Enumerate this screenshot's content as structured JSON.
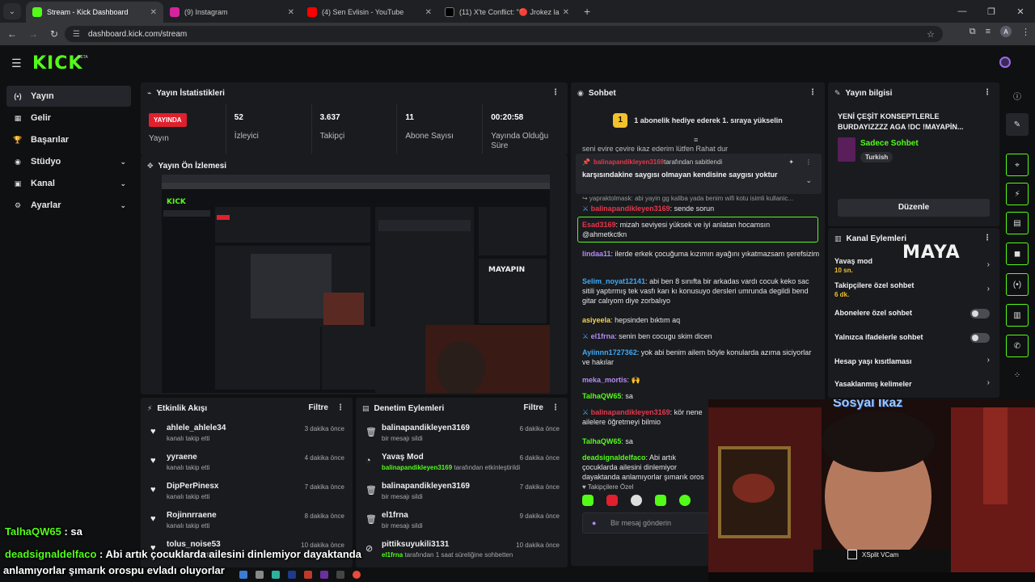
{
  "browser": {
    "tabs": [
      {
        "label": "Stream - Kick Dashboard",
        "color": "#53fc18"
      },
      {
        "label": "(9) Instagram",
        "color": "#d6249f"
      },
      {
        "label": "(4) Sen Evlisin - YouTube",
        "color": "#ff0000"
      },
      {
        "label": "(11) X'te Conflict: \"🔴 Jrokez la",
        "color": "#111111"
      }
    ],
    "url": "dashboard.kick.com/stream",
    "profile": "A"
  },
  "header": {
    "logo": "KICK",
    "beta": "BETA"
  },
  "sidebar": {
    "items": [
      {
        "label": "Yayın",
        "icon": "(•)"
      },
      {
        "label": "Gelir",
        "icon": "▦"
      },
      {
        "label": "Başarılar",
        "icon": "🏆"
      },
      {
        "label": "Stüdyo",
        "icon": "◉"
      },
      {
        "label": "Kanal",
        "icon": "▣"
      },
      {
        "label": "Ayarlar",
        "icon": "⚙"
      }
    ]
  },
  "stats_panel": {
    "title": "Yayın İstatistikleri",
    "live": "YAYINDA",
    "live_label": "Yayın",
    "stats": [
      {
        "value": "52",
        "label": "İzleyici"
      },
      {
        "value": "3.637",
        "label": "Takipçi"
      },
      {
        "value": "11",
        "label": "Abone Sayısı"
      },
      {
        "value": "00:20:58",
        "label": "Yayında Olduğu Süre"
      }
    ]
  },
  "preview_panel": {
    "title": "Yayın Ön İzlemesi"
  },
  "activity_panel": {
    "title": "Etkinlik Akışı",
    "filter": "Filtre",
    "items": [
      {
        "name": "ahlele_ahlele34",
        "desc": "kanalı takip etti",
        "time": "3 dakika önce"
      },
      {
        "name": "yyraene",
        "desc": "kanalı takip etti",
        "time": "4 dakika önce"
      },
      {
        "name": "DipPerPinesx",
        "desc": "kanalı takip etti",
        "time": "7 dakika önce"
      },
      {
        "name": "Rojinnrraene",
        "desc": "kanalı takip etti",
        "time": "8 dakika önce"
      },
      {
        "name": "tolus_noise53",
        "desc": "kanalı takip etti",
        "time": "10 dakika önce"
      }
    ]
  },
  "moderation_panel": {
    "title": "Denetim Eylemleri",
    "filter": "Filtre",
    "items": [
      {
        "name": "balinapandikleyen3169",
        "desc": "bir mesajı sildi",
        "extra": "",
        "time": "6 dakika önce",
        "icon": "🗑"
      },
      {
        "name": "Yavaş Mod",
        "desc": " tarafından etkinleştirildi",
        "extra": "balinapandikleyen3169",
        "time": "6 dakika önce",
        "icon": "◔"
      },
      {
        "name": "balinapandikleyen3169",
        "desc": "bir mesajı sildi",
        "extra": "",
        "time": "7 dakika önce",
        "icon": "🗑"
      },
      {
        "name": "el1frna",
        "desc": "bir mesajı sildi",
        "extra": "",
        "time": "9 dakika önce",
        "icon": "🗑"
      },
      {
        "name": "pittiksuyukili3131",
        "desc": " tarafından 1 saat süreliğine sohbetten",
        "extra": "el1frna",
        "time": "10 dakika önce",
        "icon": "⊘"
      }
    ]
  },
  "chat_panel": {
    "title": "Sohbet",
    "gift_banner": "1 abonelik hediye ederek 1. sıraya yükselin",
    "gift_badge": "1",
    "overflow_text": "seni evire çevire ikaz ederim lütfen Rahat dur",
    "pinned": {
      "user": "balinapandikleyen3169",
      "by": " tarafından sabitlendi",
      "text": "karşısındakine saygısı olmayan kendisine saygısı yoktur"
    },
    "reply_preview": "↪ yapraktolmask: abi yayin gg kaliba yada benim wifi kotu isimli kullanic...",
    "messages": [
      {
        "user": "balinapandikleyen3169",
        "text": "sende sorun",
        "color": "#e9364a"
      },
      {
        "user": "Esad3169",
        "text": "mizah seviyesi yüksek ve iyi anlatan hocamsın @ahmetkctkn",
        "color": "#e9364a"
      },
      {
        "user": "lindaa11",
        "text": "ilerde erkek çocuğuma kızımın ayağını yıkatmazsam şerefsizim",
        "color": "#b48cf2"
      },
      {
        "user": "Selim_noyat12141",
        "text": "abi ben 8 sınıfta bir arkadas vardı cocuk keko sac sitili yaptırmış tek vasfı karı kı konusuyo dersleri umrunda degildi bend gitar calıyom diye zorbalıyo",
        "color": "#3fa9f5"
      },
      {
        "user": "asiyeela",
        "text": "hepsinden bıktım aq",
        "color": "#f2d35b"
      },
      {
        "user": "el1frna",
        "text": "senin ben cocugu skim dicen",
        "color": "#b48cf2"
      },
      {
        "user": "Ayiinnn1727362",
        "text": "yok abi benim ailem böyle konularda azıma siciyorlar ve hakılar",
        "color": "#3fa9f5"
      },
      {
        "user": "meka_mortis",
        "text": "🙌",
        "color": "#b48cf2"
      },
      {
        "user": "TalhaQW65",
        "text": "sa",
        "color": "#53fc18"
      },
      {
        "user": "balinapandikleyen3169",
        "text": "kör nene ailelere öğretmeyi bilmio",
        "color": "#e9364a"
      },
      {
        "user": "TalhaQW65",
        "text": "sa",
        "color": "#53fc18"
      },
      {
        "user": "deadsignaldelfaco",
        "text": "Abi artık çocuklarda ailesini dinlemiyor dayaktanda anlamıyorlar şımarık oros",
        "color": "#53fc18"
      }
    ],
    "followers_label": "Takipçilere Özel",
    "input_placeholder": "Bir mesaj gönderin"
  },
  "stream_info": {
    "title": "Yayın bilgisi",
    "stream_title": "YENİ ÇEŞİT KONSEPTLERLE BURDAYIZZZZ AGA !DC !MAYAPİN...",
    "category": "Sadece Sohbet",
    "tag": "Turkish",
    "edit": "Düzenle"
  },
  "channel_actions": {
    "title": "Kanal Eylemleri",
    "sponsor": "MAYA",
    "items": [
      {
        "label": "Yavaş mod",
        "sub": "10 sn.",
        "kind": "arrow"
      },
      {
        "label": "Takipçilere özel sohbet",
        "sub": "6 dk.",
        "kind": "arrow"
      },
      {
        "label": "Abonelere özel sohbet",
        "sub": "",
        "kind": "toggle"
      },
      {
        "label": "Yalnızca ifadelerle sohbet",
        "sub": "",
        "kind": "toggle"
      },
      {
        "label": "Hesap yaşı kısıtlaması",
        "sub": "",
        "kind": "arrow"
      },
      {
        "label": "Yasaklanmış kelimeler",
        "sub": "",
        "kind": "arrow"
      }
    ]
  },
  "webcam": {
    "overlay_title": "Sosyal İkaz",
    "vcam_label": "XSplit VCam"
  },
  "overlay_chat": [
    {
      "user": "TalhaQW65",
      "text": " : sa"
    },
    {
      "user": "deadsignaldelfaco",
      "text": " : Abi artık çocuklarda ailesini dinlemiyor dayaktanda"
    },
    {
      "user": "",
      "text": "anlamıyorlar şımarık orospu evladı oluyorlar"
    }
  ]
}
